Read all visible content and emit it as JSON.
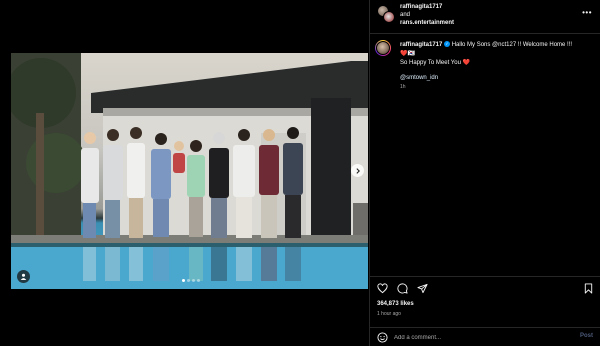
{
  "post": {
    "account_primary": "raffinagita1717",
    "joiner": "and",
    "account_secondary": "rans.entertainment",
    "more_label": "•••",
    "caption_user": "raffinagita1717",
    "caption_text": "Hallo My Sons @nct127 !! Welcome Home !!!",
    "caption_line2": "❤️🇰🇷",
    "caption_line3": "So Happy To Meet You ❤️",
    "caption_mention": "@smtown_idn",
    "caption_time": "1h",
    "likes": "364,873 likes",
    "posted_time": "1 hour ago",
    "comment_placeholder": "Add a comment...",
    "post_label": "Post"
  },
  "carousel": {
    "current": 1,
    "total": 4
  },
  "icons": [
    "heart-icon",
    "comment-icon",
    "share-icon",
    "bookmark-icon",
    "emoji-icon",
    "user-tag-icon",
    "chevron-right-icon",
    "verified-badge-icon"
  ],
  "colors": {
    "background": "#000000",
    "divider": "#262626",
    "verified": "#0095f6",
    "post_button": "#4c5a7a",
    "muted_text": "#a8a8a8"
  }
}
